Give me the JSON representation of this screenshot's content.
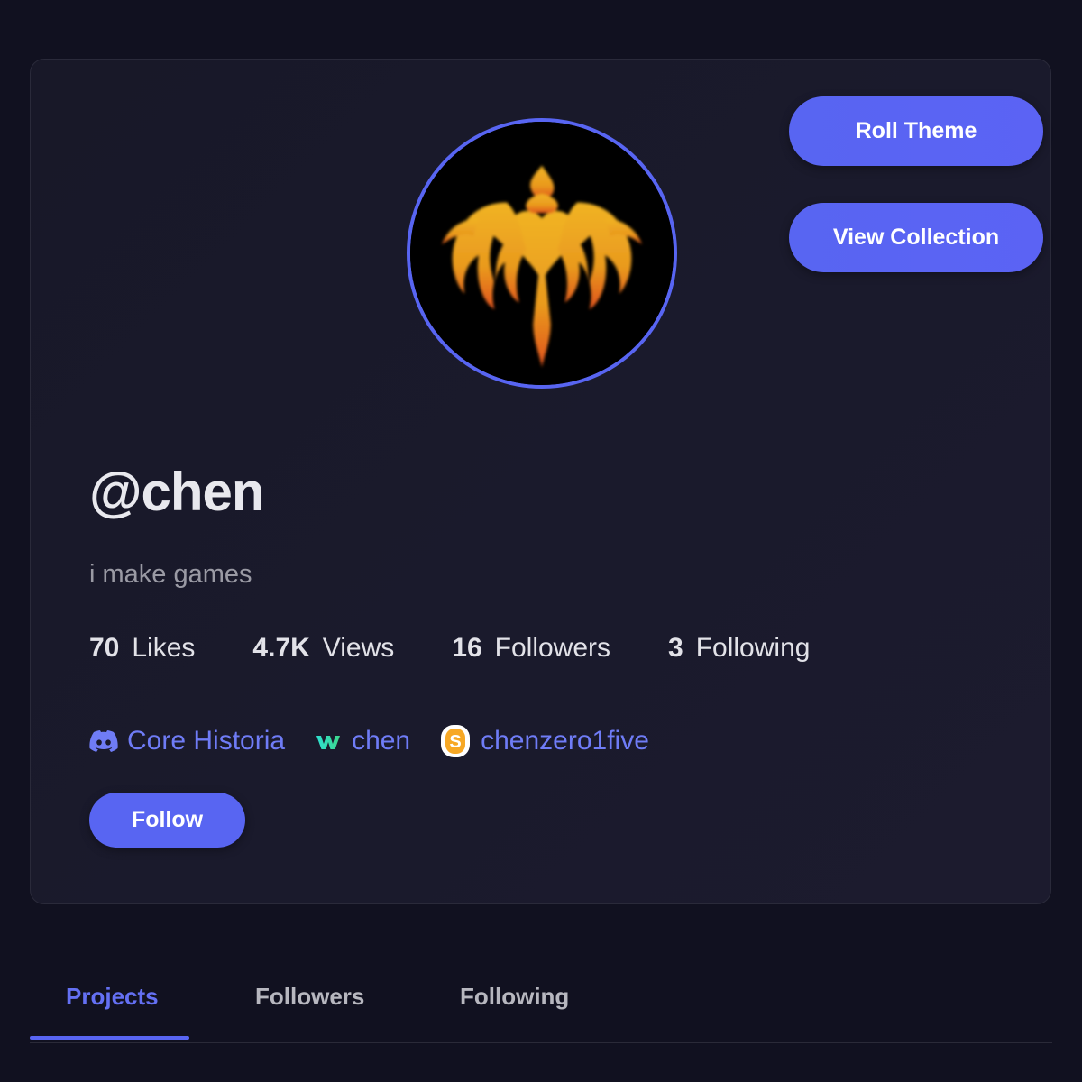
{
  "profile": {
    "username": "@chen",
    "bio": "i make games",
    "avatar_icon": "flame-emblem-icon",
    "buttons": {
      "roll_theme": "Roll Theme",
      "view_collection": "View Collection",
      "follow": "Follow"
    },
    "stats": [
      {
        "value": "70",
        "label": "Likes"
      },
      {
        "value": "4.7K",
        "label": "Views"
      },
      {
        "value": "16",
        "label": "Followers"
      },
      {
        "value": "3",
        "label": "Following"
      }
    ],
    "links": [
      {
        "icon": "discord-icon",
        "label": "Core Historia"
      },
      {
        "icon": "w-logo-icon",
        "label": "chen"
      },
      {
        "icon": "scratch-icon",
        "label": "chenzero1five"
      }
    ]
  },
  "tabs": [
    {
      "label": "Projects",
      "active": true
    },
    {
      "label": "Followers",
      "active": false
    },
    {
      "label": "Following",
      "active": false
    }
  ],
  "colors": {
    "accent": "#5865f2",
    "background": "#111120",
    "card": "#1a1a2c",
    "link": "#6f7cf6"
  }
}
